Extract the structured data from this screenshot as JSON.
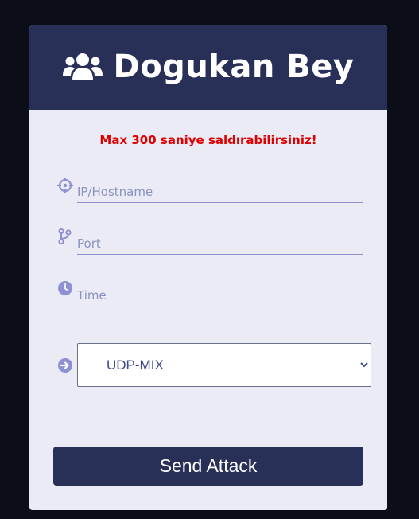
{
  "header": {
    "title": "Dogukan Bey",
    "icon": "users-icon"
  },
  "warning": "Max 300 saniye saldırabilirsiniz!",
  "form": {
    "host": {
      "placeholder": "IP/Hostname",
      "value": "",
      "icon": "crosshair-icon"
    },
    "port": {
      "placeholder": "Port",
      "value": "",
      "icon": "code-branch-icon"
    },
    "time": {
      "placeholder": "Time",
      "value": "",
      "icon": "clock-icon"
    },
    "method": {
      "selected": "UDP-MIX",
      "icon": "arrow-circle-right-icon"
    }
  },
  "send_button": "Send Attack",
  "colors": {
    "page_bg": "#0b0d19",
    "card_bg": "#ebebf6",
    "header_bg": "#283058",
    "accent": "#8e90d4",
    "warning": "#e00000"
  }
}
